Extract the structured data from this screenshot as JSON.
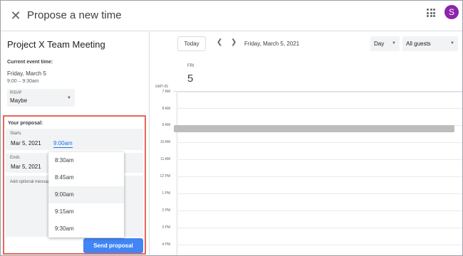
{
  "header": {
    "close_icon": "close-icon",
    "title": "Propose a new time",
    "apps_icon": "apps-grid-icon",
    "avatar_letter": "S",
    "avatar_color": "#8e24aa"
  },
  "left": {
    "meeting_title": "Project X Team Meeting",
    "current_label": "Current event time:",
    "current_date": "Friday, March 5",
    "current_time": "9:00 – 9:30am",
    "rsvp_label": "RSVP",
    "rsvp_value": "Maybe"
  },
  "proposal": {
    "title": "Your proposal:",
    "starts_label": "Starts",
    "start_date": "Mar 5, 2021",
    "start_time": "9:00am",
    "ends_label": "Ends",
    "end_date": "Mar 5, 2021",
    "message_placeholder": "Add optional message",
    "send_label": "Send proposal",
    "highlight_color": "#e8665b",
    "accent_color": "#4285f4"
  },
  "dropdown": {
    "options": [
      "8:30am",
      "8:45am",
      "9:00am",
      "9:15am",
      "9:30am"
    ],
    "selected": "9:00am"
  },
  "calendar": {
    "today_label": "Today",
    "date_label": "Friday, March 5, 2021",
    "view_label": "Day",
    "guests_label": "All guests",
    "day_of_week": "FRI",
    "day_number": "5",
    "timezone": "GMT-05",
    "hours": [
      "7 AM",
      "8 AM",
      "9 AM",
      "10 AM",
      "11 AM",
      "12 PM",
      "1 PM",
      "2 PM",
      "3 PM",
      "4 PM"
    ]
  }
}
